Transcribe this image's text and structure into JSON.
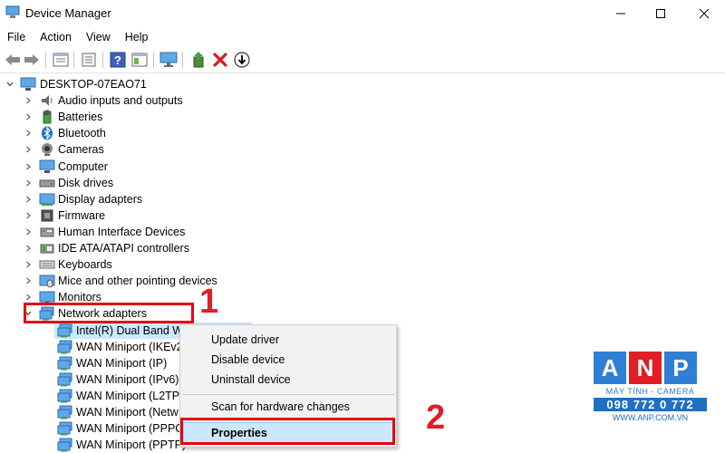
{
  "window": {
    "title": "Device Manager",
    "icon": "device-manager-icon"
  },
  "menu": [
    "File",
    "Action",
    "View",
    "Help"
  ],
  "toolbar": {
    "icons": [
      "back-arrow-icon",
      "forward-arrow-icon",
      "properties-sheet-icon",
      "computer-list-icon",
      "help-icon",
      "view-icon",
      "monitor-icon",
      "update-driver-icon",
      "uninstall-x-icon",
      "download-icon"
    ]
  },
  "tree": {
    "root": "DESKTOP-07EAO71",
    "categories": [
      {
        "label": "Audio inputs and outputs",
        "icon": "speaker-icon"
      },
      {
        "label": "Batteries",
        "icon": "battery-icon"
      },
      {
        "label": "Bluetooth",
        "icon": "bluetooth-icon"
      },
      {
        "label": "Cameras",
        "icon": "camera-icon"
      },
      {
        "label": "Computer",
        "icon": "computer-icon"
      },
      {
        "label": "Disk drives",
        "icon": "disk-drive-icon"
      },
      {
        "label": "Display adapters",
        "icon": "display-adapter-icon"
      },
      {
        "label": "Firmware",
        "icon": "firmware-icon"
      },
      {
        "label": "Human Interface Devices",
        "icon": "hid-icon"
      },
      {
        "label": "IDE ATA/ATAPI controllers",
        "icon": "ide-controller-icon"
      },
      {
        "label": "Keyboards",
        "icon": "keyboard-icon"
      },
      {
        "label": "Mice and other pointing devices",
        "icon": "mouse-icon"
      },
      {
        "label": "Monitors",
        "icon": "monitor-icon"
      },
      {
        "label": "Network adapters",
        "icon": "network-adapter-icon"
      }
    ],
    "network_children": [
      "Intel(R) Dual Band Wi",
      "WAN Miniport (IKEv2",
      "WAN Miniport (IP)",
      "WAN Miniport (IPv6)",
      "WAN Miniport (L2TP)",
      "WAN Miniport (Netw",
      "WAN Miniport (PPPO",
      "WAN Miniport (PPTP)"
    ]
  },
  "context_menu": {
    "items": [
      "Update driver",
      "Disable device",
      "Uninstall device",
      "Scan for hardware changes",
      "Properties"
    ]
  },
  "annotations": {
    "step1": "1",
    "step2": "2",
    "color": "#e60012"
  },
  "watermark": {
    "letters": [
      "A",
      "N",
      "P"
    ],
    "letter_colors": [
      "#2f7fd6",
      "#e01e26",
      "#2f7fd6"
    ],
    "tagline": "MÁY TÍNH - CAMERA",
    "phone": "098 772 0 772",
    "website": "WWW.ANP.COM.VN"
  }
}
